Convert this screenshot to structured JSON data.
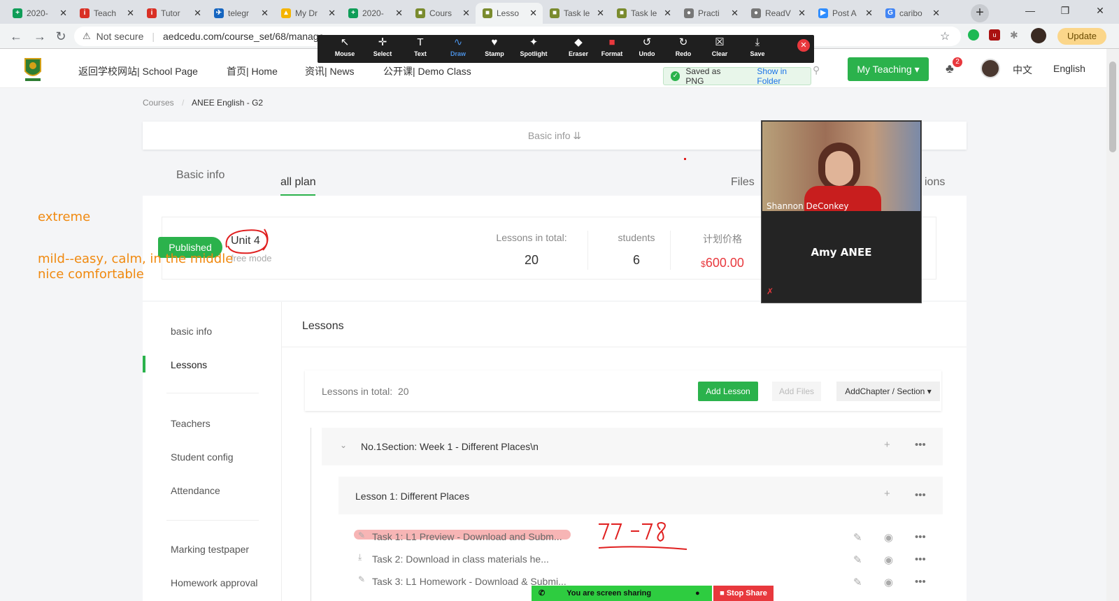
{
  "browser": {
    "tabs": [
      {
        "label": "2020-",
        "icon": "sheets-icon",
        "color": "#0f9d58"
      },
      {
        "label": "Teach",
        "icon": "i-icon",
        "color": "#d93025"
      },
      {
        "label": "Tutor",
        "icon": "i-icon",
        "color": "#d93025"
      },
      {
        "label": "telegr",
        "icon": "telegram-icon",
        "color": "#1565c0"
      },
      {
        "label": "My Dr",
        "icon": "drive-icon",
        "color": "#f4b400"
      },
      {
        "label": "2020-",
        "icon": "sheets-icon",
        "color": "#0f9d58"
      },
      {
        "label": "Cours",
        "icon": "page-icon",
        "color": "#7a8b2e"
      },
      {
        "label": "Lesso",
        "icon": "page-icon",
        "color": "#7a8b2e"
      },
      {
        "label": "Task le",
        "icon": "page-icon",
        "color": "#7a8b2e"
      },
      {
        "label": "Task le",
        "icon": "page-icon",
        "color": "#7a8b2e"
      },
      {
        "label": "Practi",
        "icon": "globe-icon",
        "color": "#777777"
      },
      {
        "label": "ReadV",
        "icon": "globe-icon",
        "color": "#777777"
      },
      {
        "label": "Post A",
        "icon": "zoom-icon",
        "color": "#2d8cff"
      },
      {
        "label": "caribo",
        "icon": "google-icon",
        "color": "#4285f4"
      }
    ],
    "not_secure": "Not secure",
    "url": "aedcedu.com/course_set/68/manage",
    "url_tail": "...921/...",
    "update": "Update"
  },
  "header": {
    "nav": [
      "返回学校网站| School Page",
      "首页| Home",
      "资讯| News",
      "公开课| Demo Class"
    ],
    "my_teaching": "My Teaching",
    "notif_count": "2",
    "lang_cn": "中文",
    "lang_en": "English"
  },
  "zoom_toolbar": {
    "buttons": [
      "Mouse",
      "Select",
      "Text",
      "Draw",
      "Stamp",
      "Spotlight",
      "Eraser",
      "Format",
      "Undo",
      "Redo",
      "Clear",
      "Save"
    ],
    "saved_msg": "Saved as PNG",
    "show_folder": "Show in Folder"
  },
  "breadcrumb": {
    "root": "Courses",
    "sep": "/",
    "current": "ANEE English - G2"
  },
  "basic_info_bar": "Basic info",
  "page_tabs": {
    "basic": "Basic info",
    "plan": "all plan",
    "files": "Files",
    "cut": "ions"
  },
  "plan": {
    "badge": "Published",
    "title": "Unit 4",
    "mode": "free mode",
    "stats": [
      {
        "label": "Lessons in total:",
        "value": "20"
      },
      {
        "label": "students",
        "value": "6"
      },
      {
        "label": "计划价格",
        "currency": "$",
        "value": "600.00"
      }
    ]
  },
  "sidebar": {
    "items": [
      "basic info",
      "Lessons",
      "Teachers",
      "Student config",
      "Attendance",
      "Marking testpaper",
      "Homework approval"
    ]
  },
  "lessons": {
    "heading": "Lessons",
    "total_label": "Lessons in total:",
    "total_value": "20",
    "add_lesson": "Add Lesson",
    "add_files": "Add Files",
    "add_chapter": "AddChapter / Section",
    "section": "No.1Section:  Week 1 - Different Places\\n",
    "lesson": "Lesson 1:   Different Places",
    "tasks": [
      {
        "label": "Task 1:   L1 Preview - Download and Subm..."
      },
      {
        "label": "Task 2:   Download in class materials he..."
      },
      {
        "label": "Task 3:   L1 Homework - Download & Submi..."
      }
    ]
  },
  "annotations": {
    "extreme": "extreme",
    "mild1": "mild--easy, calm, in the middle",
    "mild2": "nice comfortable",
    "handwritten": "77-78"
  },
  "video": {
    "participant1": "Shannon DeConkey",
    "participant2": "Amy ANEE"
  },
  "sharebar": {
    "sharing": "You are screen sharing",
    "stop": "Stop Share"
  },
  "colors": {
    "accent": "#2bb24c",
    "price": "#e8383d",
    "annotation": "#f0890f",
    "ink": "#e02020"
  }
}
